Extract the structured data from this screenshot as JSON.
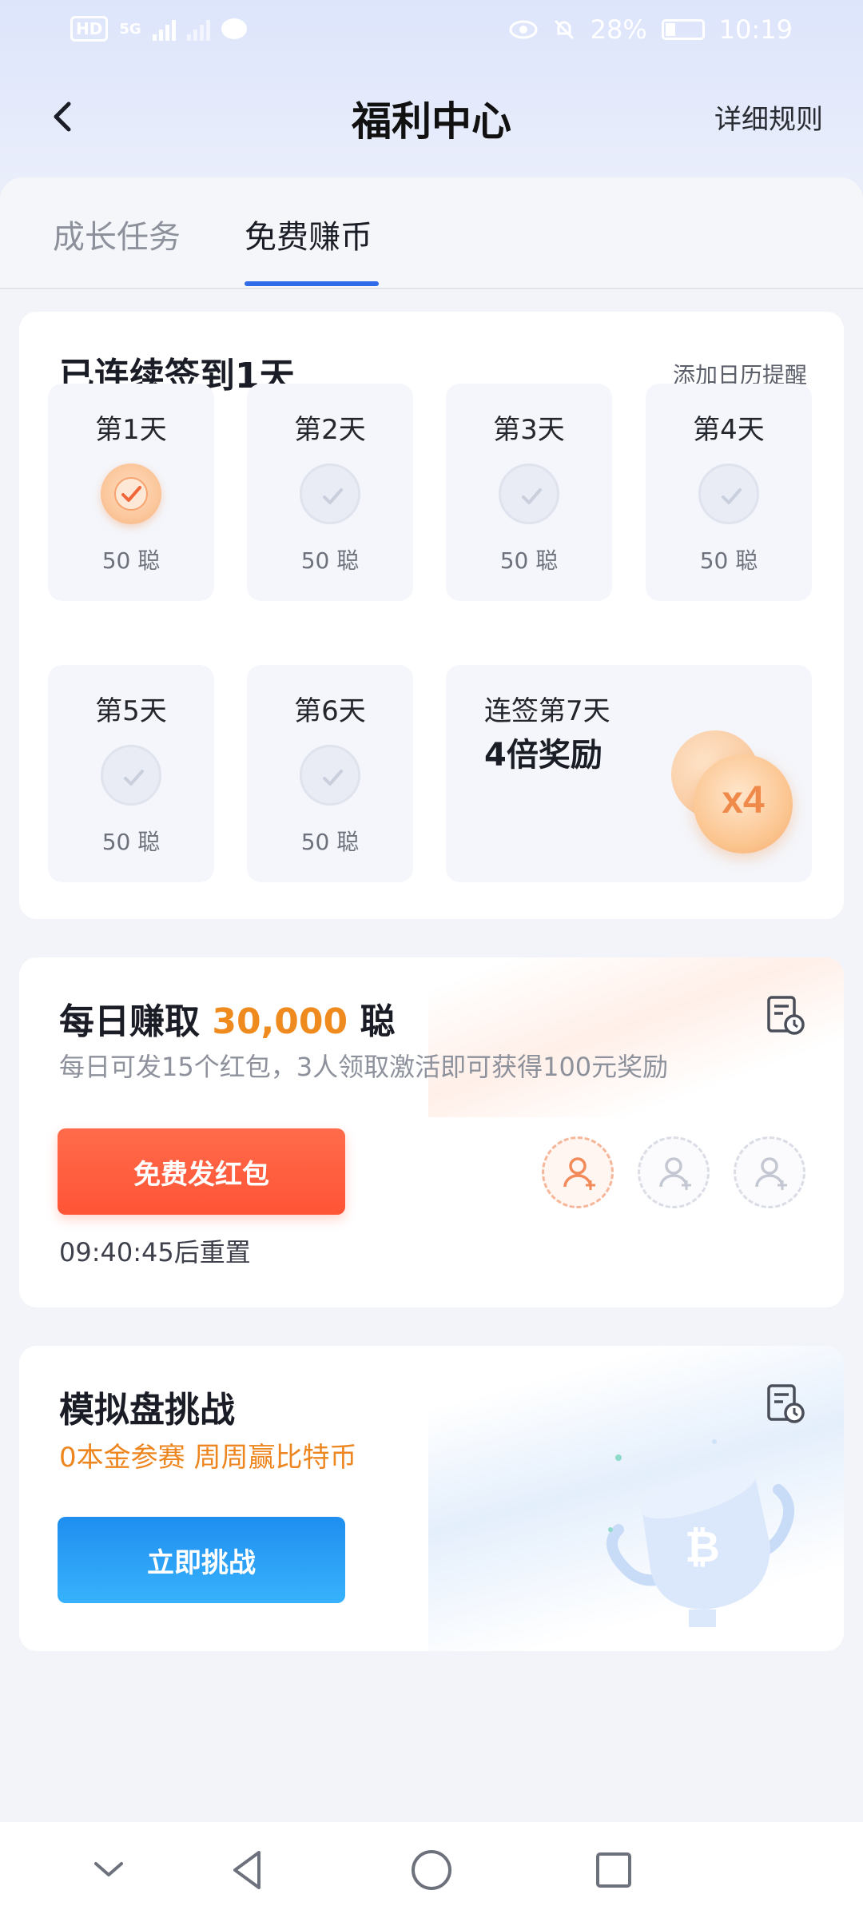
{
  "status_bar": {
    "hd": "HD",
    "net": "5G",
    "battery": "28%",
    "time": "10:19"
  },
  "header": {
    "title": "福利中心",
    "rules": "详细规则"
  },
  "tabs": [
    {
      "label": "成长任务",
      "active": false
    },
    {
      "label": "免费赚币",
      "active": true
    }
  ],
  "signin": {
    "title": "已连续签到1天",
    "calendar_link": "添加日历提醒",
    "days": [
      {
        "label": "第1天",
        "points": "50 聪",
        "checked": true
      },
      {
        "label": "第2天",
        "points": "50 聪",
        "checked": false
      },
      {
        "label": "第3天",
        "points": "50 聪",
        "checked": false
      },
      {
        "label": "第4天",
        "points": "50 聪",
        "checked": false
      },
      {
        "label": "第5天",
        "points": "50 聪",
        "checked": false
      },
      {
        "label": "第6天",
        "points": "50 聪",
        "checked": false
      }
    ],
    "day7": {
      "label": "连签第7天",
      "reward": "4倍奖励",
      "coin_text": "x4"
    }
  },
  "earn": {
    "title_prefix": "每日赚取",
    "amount": "30,000",
    "unit": "聪",
    "subtitle": "每日可发15个红包，3人领取激活即可获得100元奖励",
    "button": "免费发红包",
    "reset": "09:40:45后重置",
    "invite_slots": 3
  },
  "sim": {
    "title": "模拟盘挑战",
    "subtitle": "0本金参赛 周周赢比特币",
    "button": "立即挑战"
  },
  "colors": {
    "accent_blue": "#2f6ae8",
    "orange": "#ef8a1e",
    "red_button": "#ff5a3c",
    "blue_button": "#2a9ef5"
  }
}
